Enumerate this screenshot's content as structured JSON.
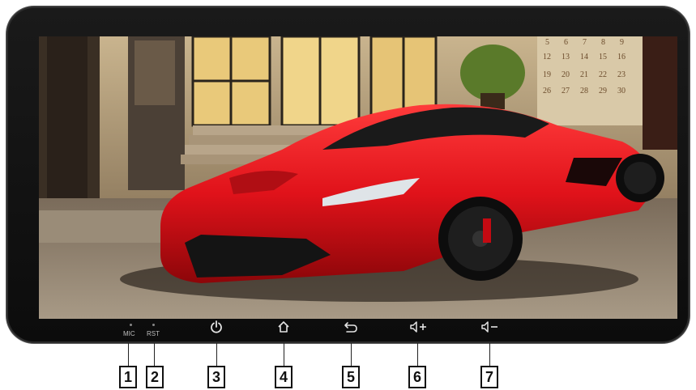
{
  "buttons": {
    "mic_label": "MIC",
    "rst_label": "RST"
  },
  "icons": [
    "power-icon",
    "home-icon",
    "back-icon",
    "volume-up-icon",
    "volume-down-icon"
  ],
  "callouts": [
    "1",
    "2",
    "3",
    "4",
    "5",
    "6",
    "7"
  ],
  "wallpaper": {
    "subject": "red sports car",
    "calendar_numbers": [
      "5",
      "6",
      "7",
      "8",
      "9",
      "12",
      "13",
      "14",
      "15",
      "16",
      "19",
      "20",
      "21",
      "22",
      "23",
      "26",
      "27",
      "28",
      "29",
      "30"
    ]
  },
  "colors": {
    "bezel": "#111111",
    "icon": "#e4e4e4",
    "car": "#e0121a"
  }
}
